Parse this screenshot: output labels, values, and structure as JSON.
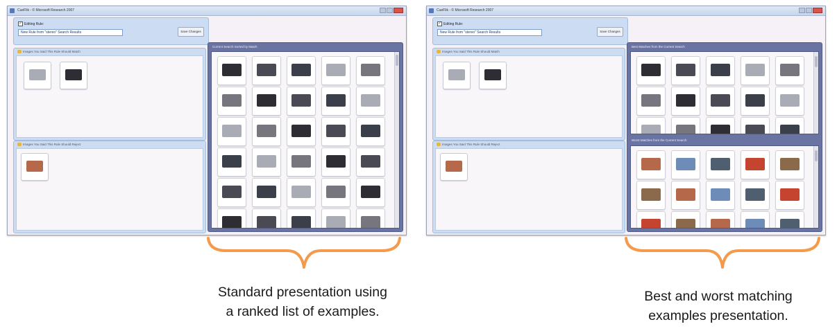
{
  "window_title": "CueFlik - © Microsoft Research 2007",
  "editing_label": "Editing Rule:",
  "rule_name": "New Rule from \"stereo\" Search Results",
  "save_button": "Save Changes",
  "match_pane_title": "Images You Said This Rule Should Match",
  "reject_pane_title": "Images You Said This Rule Should Reject",
  "left_window": {
    "results_title": "Current Search Sorted by Match"
  },
  "right_window": {
    "best_title": "Best Matches from the Current Search",
    "worst_title": "Worst Matches from the Current Search"
  },
  "captions": {
    "left_line1": "Standard presentation using",
    "left_line2": "a ranked list of examples.",
    "right_line1": "Best and worst matching",
    "right_line2": "examples presentation."
  },
  "colors": {
    "brace": "#f39a4c",
    "pane_blue": "#cbdcf3",
    "results_panel": "#6a74a3",
    "device_dark": "#2d2d33",
    "device_silver": "#a9acb4",
    "photo_warm": "#b5694a",
    "photo_red": "#c4442f"
  }
}
